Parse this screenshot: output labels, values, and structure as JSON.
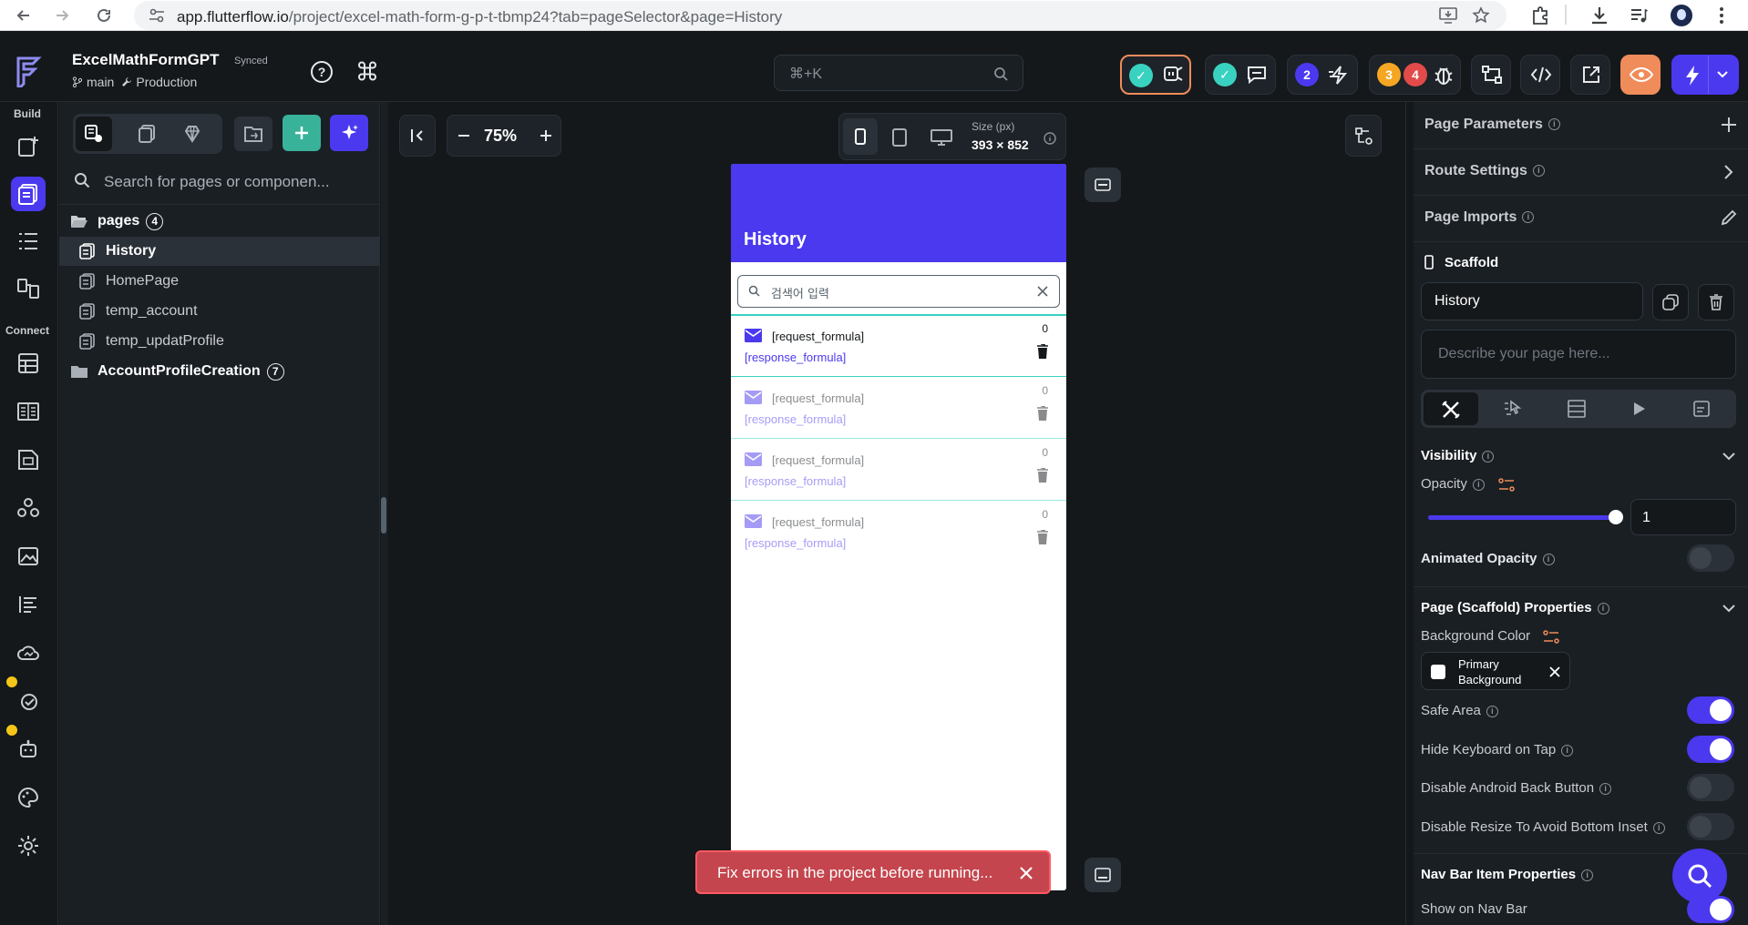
{
  "browser": {
    "url_host": "app.flutterflow.io",
    "url_path": "/project/excel-math-form-g-p-t-tbmp24?tab=pageSelector&page=History"
  },
  "header": {
    "project_name": "ExcelMathFormGPT",
    "sync_status": "Synced",
    "branch": "main",
    "environment": "Production",
    "command_search": "⌘+K",
    "badge_blue": "2",
    "badge_orange": "3",
    "badge_red": "4"
  },
  "rail": {
    "build_label": "Build",
    "connect_label": "Connect"
  },
  "explorer": {
    "search_placeholder": "Search for pages or componen...",
    "pages_folder": "pages",
    "pages_count": "4",
    "pages": [
      "History",
      "HomePage",
      "temp_account",
      "temp_updatProfile"
    ],
    "folder2": "AccountProfileCreation",
    "folder2_count": "7"
  },
  "canvas": {
    "zoom": "75%",
    "size_label": "Size (px)",
    "size_value": "393 × 852"
  },
  "phone": {
    "title": "History",
    "search_placeholder": "검색어 입력",
    "items": [
      {
        "request": "[request_formula]",
        "response": "[response_formula]",
        "count": "0"
      },
      {
        "request": "[request_formula]",
        "response": "[response_formula]",
        "count": "0"
      },
      {
        "request": "[request_formula]",
        "response": "[response_formula]",
        "count": "0"
      },
      {
        "request": "[request_formula]",
        "response": "[response_formula]",
        "count": "0"
      }
    ]
  },
  "toast": {
    "message": "Fix errors in the project before running..."
  },
  "props": {
    "page_parameters": "Page Parameters",
    "route_settings": "Route Settings",
    "page_imports": "Page Imports",
    "scaffold_label": "Scaffold",
    "page_name": "History",
    "description_placeholder": "Describe your page here...",
    "visibility": "Visibility",
    "opacity": "Opacity",
    "opacity_value": "1",
    "opacity_fraction": 1,
    "animated_opacity": "Animated Opacity",
    "scaffold_props": "Page (Scaffold) Properties",
    "background_color": "Background Color",
    "bg_color_value_line1": "Primary",
    "bg_color_value_line2": "Background",
    "safe_area": "Safe Area",
    "hide_keyboard": "Hide Keyboard on Tap",
    "disable_back": "Disable Android Back Button",
    "disable_resize": "Disable Resize To Avoid Bottom Inset",
    "nav_bar_props": "Nav Bar Item Properties",
    "show_on_nav": "Show on Nav Bar"
  },
  "colors": {
    "primary": "#4b39ef",
    "secondary": "#39d2c0",
    "error": "#ff5963"
  }
}
